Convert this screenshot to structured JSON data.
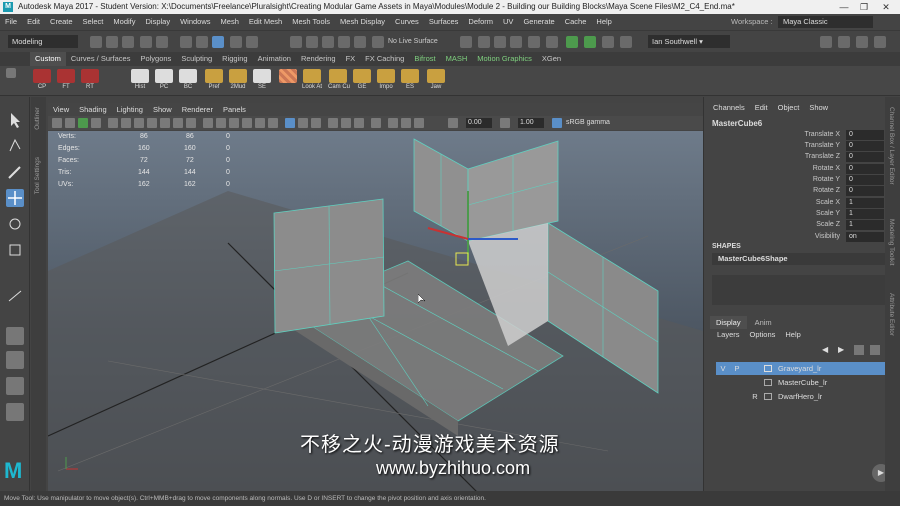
{
  "window": {
    "title": "Autodesk Maya 2017 - Student Version: X:\\Documents\\Freelance\\Pluralsight\\Creating Modular Game Assets in Maya\\Modules\\Module 2 - Building our Building Blocks\\Maya Scene Files\\M2_C4_End.ma*",
    "app_icon": "M"
  },
  "menubar": [
    "File",
    "Edit",
    "Create",
    "Select",
    "Modify",
    "Display",
    "Windows",
    "Mesh",
    "Edit Mesh",
    "Mesh Tools",
    "Mesh Display",
    "Curves",
    "Surfaces",
    "Deform",
    "UV",
    "Generate",
    "Cache",
    "Help"
  ],
  "workspace": {
    "label": "Workspace :",
    "value": "Maya Classic"
  },
  "statusline": {
    "mode": "Modeling",
    "live_surface": "No Live Surface",
    "user": "Ian Southwell"
  },
  "shelf": {
    "tabs": [
      "Custom",
      "Curves / Surfaces",
      "Polygons",
      "Sculpting",
      "Rigging",
      "Animation",
      "Rendering",
      "FX",
      "FX Caching",
      "Bifrost",
      "MASH",
      "Motion Graphics",
      "XGen"
    ],
    "active_tab": "Custom",
    "items": [
      "CP",
      "FT",
      "RT",
      "Hist",
      "PC",
      "BC",
      "Pref",
      "2Mud",
      "SE",
      "Look At",
      "Cam Cu",
      "GE",
      "Impo",
      "ES",
      "Jaw"
    ]
  },
  "panel": {
    "menu": [
      "View",
      "Shading",
      "Lighting",
      "Show",
      "Renderer",
      "Panels"
    ],
    "exposure": "0.00",
    "gamma": "1.00",
    "colorspace": "sRGB gamma"
  },
  "hud": {
    "rows": [
      {
        "label": "Verts:",
        "a": "86",
        "b": "86",
        "c": "0"
      },
      {
        "label": "Edges:",
        "a": "160",
        "b": "160",
        "c": "0"
      },
      {
        "label": "Faces:",
        "a": "72",
        "b": "72",
        "c": "0"
      },
      {
        "label": "Tris:",
        "a": "144",
        "b": "144",
        "c": "0"
      },
      {
        "label": "UVs:",
        "a": "162",
        "b": "162",
        "c": "0"
      }
    ]
  },
  "side_tabs": {
    "left1": "Outliner",
    "left2": "Tool Settings",
    "right1": "Channel Box / Layer Editor",
    "right2": "Modeling Toolkit",
    "right3": "Attribute Editor"
  },
  "channelbox": {
    "menu": [
      "Channels",
      "Edit",
      "Object",
      "Show"
    ],
    "object": "MasterCube6",
    "attributes": [
      {
        "name": "Translate X",
        "value": "0"
      },
      {
        "name": "Translate Y",
        "value": "0"
      },
      {
        "name": "Translate Z",
        "value": "0"
      },
      {
        "name": "Rotate X",
        "value": "0"
      },
      {
        "name": "Rotate Y",
        "value": "0"
      },
      {
        "name": "Rotate Z",
        "value": "0"
      },
      {
        "name": "Scale X",
        "value": "1"
      },
      {
        "name": "Scale Y",
        "value": "1"
      },
      {
        "name": "Scale Z",
        "value": "1"
      },
      {
        "name": "Visibility",
        "value": "on"
      }
    ],
    "shapes_header": "SHAPES",
    "shape": "MasterCube6Shape"
  },
  "layers": {
    "tabs": [
      "Display",
      "Anim"
    ],
    "menu": [
      "Layers",
      "Options",
      "Help"
    ],
    "items": [
      {
        "v": "V",
        "p": "P",
        "name": "Graveyard_lr",
        "selected": true
      },
      {
        "v": "",
        "p": "",
        "name": "MasterCube_lr",
        "selected": false
      },
      {
        "v": "",
        "p": "R",
        "name": "DwarfHero_lr",
        "selected": false
      }
    ]
  },
  "helpline": "Move Tool: Use manipulator to move object(s). Ctrl+MMB+drag to move components along normals. Use D or INSERT to change the pivot position and axis orientation.",
  "watermark": {
    "line1": "不移之火-动漫游戏美术资源",
    "line2": "www.byzhihuo.com"
  },
  "colors": {
    "bg": "#444444",
    "accent_teal": "#5fd1c0",
    "selection": "#5a8fc8"
  }
}
